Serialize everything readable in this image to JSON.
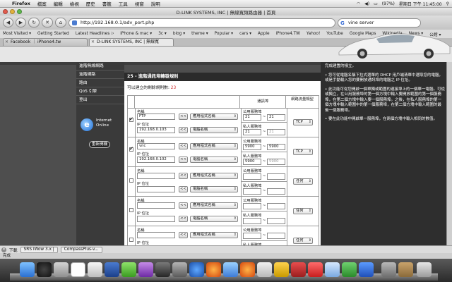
{
  "menubar": {
    "app": "Firefox",
    "items": [
      "檔案",
      "編輯",
      "檢視",
      "歷史",
      "書籤",
      "工具",
      "視窗",
      "說明"
    ],
    "clock": "星期日 下午 11:45:00",
    "battery": "(97%)"
  },
  "window": {
    "title": "D-LINK SYSTEMS, INC | 無線寬頻路由器 | 首頁"
  },
  "nav": {
    "url": "http://192.168.0.1/adv_port.php",
    "search_value": "vine server"
  },
  "bookmarks": [
    "Most Visited ▾",
    "Getting Started",
    "Latest Headlines ⁝›",
    "iPhone & mac ▾",
    "3c ▾",
    "blog ▾",
    "theme ▾",
    "Popular ▾",
    "cars ▾",
    "Apple",
    "iPhone4.TW",
    "Yahoo!",
    "YouTube",
    "Google Maps",
    "Wikipedia",
    "News ▾",
    "公館 ▾"
  ],
  "tabs": [
    {
      "label": "Facebook ｜ iPhone4.tw",
      "active": false
    },
    {
      "label": "D-LINK SYSTEMS, INC | 無線寬",
      "active": true
    }
  ],
  "sidenav": {
    "items": [
      "進階無線網路",
      "進階網路",
      "路由",
      "QoS 引擎",
      "登出"
    ],
    "internet_label": "Internet\nOnline",
    "restart": "重新開機"
  },
  "panel": {
    "title": "25 - 進階通訊埠轉發規則",
    "available_label": "可以建立的剩餘規則數:",
    "available_count": "23",
    "col_ports": "通訊埠",
    "col_traffic": "網路流量類型",
    "name_label": "名稱",
    "ip_label": "IP 位址",
    "public_label": "公用服務埠",
    "private_label": "私人服務埠",
    "arrow_btn": "<<",
    "app_select": "應用程式名稱",
    "pc_select": "電腦名稱",
    "rules": [
      {
        "checked": true,
        "name": "FTP",
        "ip": "192.168.0.103",
        "pub_start": "21",
        "pub_end": "21",
        "priv_start": "21",
        "priv_end": "21",
        "traffic": "TCP"
      },
      {
        "checked": true,
        "name": "vnc",
        "ip": "192.168.0.102",
        "pub_start": "5900",
        "pub_end": "5900",
        "priv_start": "5900",
        "priv_end": "5900",
        "traffic": "TCP"
      },
      {
        "checked": false,
        "name": "",
        "ip": "",
        "pub_start": "",
        "pub_end": "",
        "priv_start": "",
        "priv_end": "",
        "traffic": "任何"
      },
      {
        "checked": false,
        "name": "",
        "ip": "",
        "pub_start": "",
        "pub_end": "",
        "priv_start": "",
        "priv_end": "",
        "traffic": "任何"
      },
      {
        "checked": false,
        "name": "",
        "ip": "",
        "pub_start": "",
        "pub_end": "",
        "priv_start": "",
        "priv_end": "",
        "traffic": "任何"
      }
    ]
  },
  "help": [
    "完成建置的樣立。",
    "• 您可從電腦名稱下拉式選單的 DHCP 用戶端清單中選取您的電腦，或是手動輸入您的要開放通訊埠的電腦之 IP 位址。",
    "• 此功能可從您開啟一個單獨或範圍的連接埠上的一個單一電腦。可從或獨立，在公用服務埠的第一個方塊中輸入要開放範圍的第一個服務埠，在第二個方塊中輸入要一個服務埠。之後，在私人服務埠的第一個方塊中輸入範圍中的第一個服務埠，在第二個方塊中輸入範圍的最後一個服務埠。",
    "• 要在此功能中開啟單一服務埠，在兩個方塊中輸入相同的數值。"
  ],
  "statusbar": {
    "done": "完成",
    "download": "下載",
    "tasks": [
      "SRS iWow 3.x |",
      "CompassPlus-v..."
    ]
  },
  "colors": {
    "accent_red": "#d03030",
    "panel_header": "#2b2b2b",
    "sidebar": "#3a3a3a"
  }
}
